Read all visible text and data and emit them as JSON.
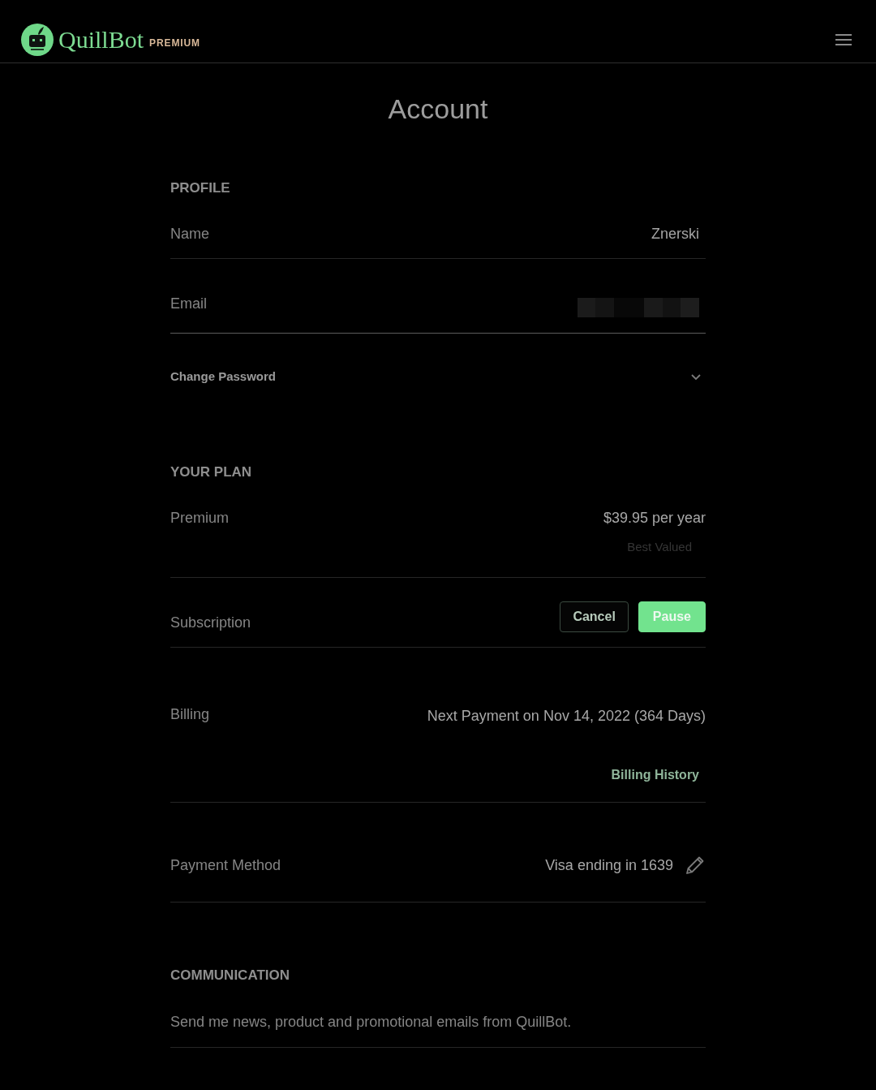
{
  "header": {
    "wordmark": "QuillBot",
    "badge": "PREMIUM"
  },
  "page_title": "Account",
  "sections": [
    {
      "heading": "PROFILE",
      "items": [
        {
          "kind": "field",
          "label": "Name",
          "value": "Znerski",
          "focused": false,
          "redacted": false
        },
        {
          "kind": "field",
          "label": "Email",
          "focused": true,
          "redacted": true
        },
        {
          "kind": "expander",
          "label": "Change Password",
          "expanded": false
        }
      ]
    },
    {
      "heading": "YOUR PLAN",
      "items": [
        {
          "kind": "plan",
          "label": "Premium",
          "price": "$39.95 per year",
          "note": "Best Valued"
        },
        {
          "kind": "actions",
          "label": "Subscription",
          "buttons": [
            {
              "label": "Cancel",
              "kind": "outline"
            },
            {
              "label": "Pause",
              "kind": "filled"
            }
          ]
        },
        {
          "kind": "billing",
          "label": "Billing",
          "value": "Next Payment on Nov 14, 2022 (364 Days)",
          "link": "Billing History"
        },
        {
          "kind": "payment",
          "label": "Payment Method",
          "value": "Visa ending in 1639"
        }
      ]
    },
    {
      "heading": "COMMUNICATION",
      "items": [
        {
          "kind": "text",
          "text": "Send me news, product and promotional emails from QuillBot."
        }
      ]
    }
  ]
}
